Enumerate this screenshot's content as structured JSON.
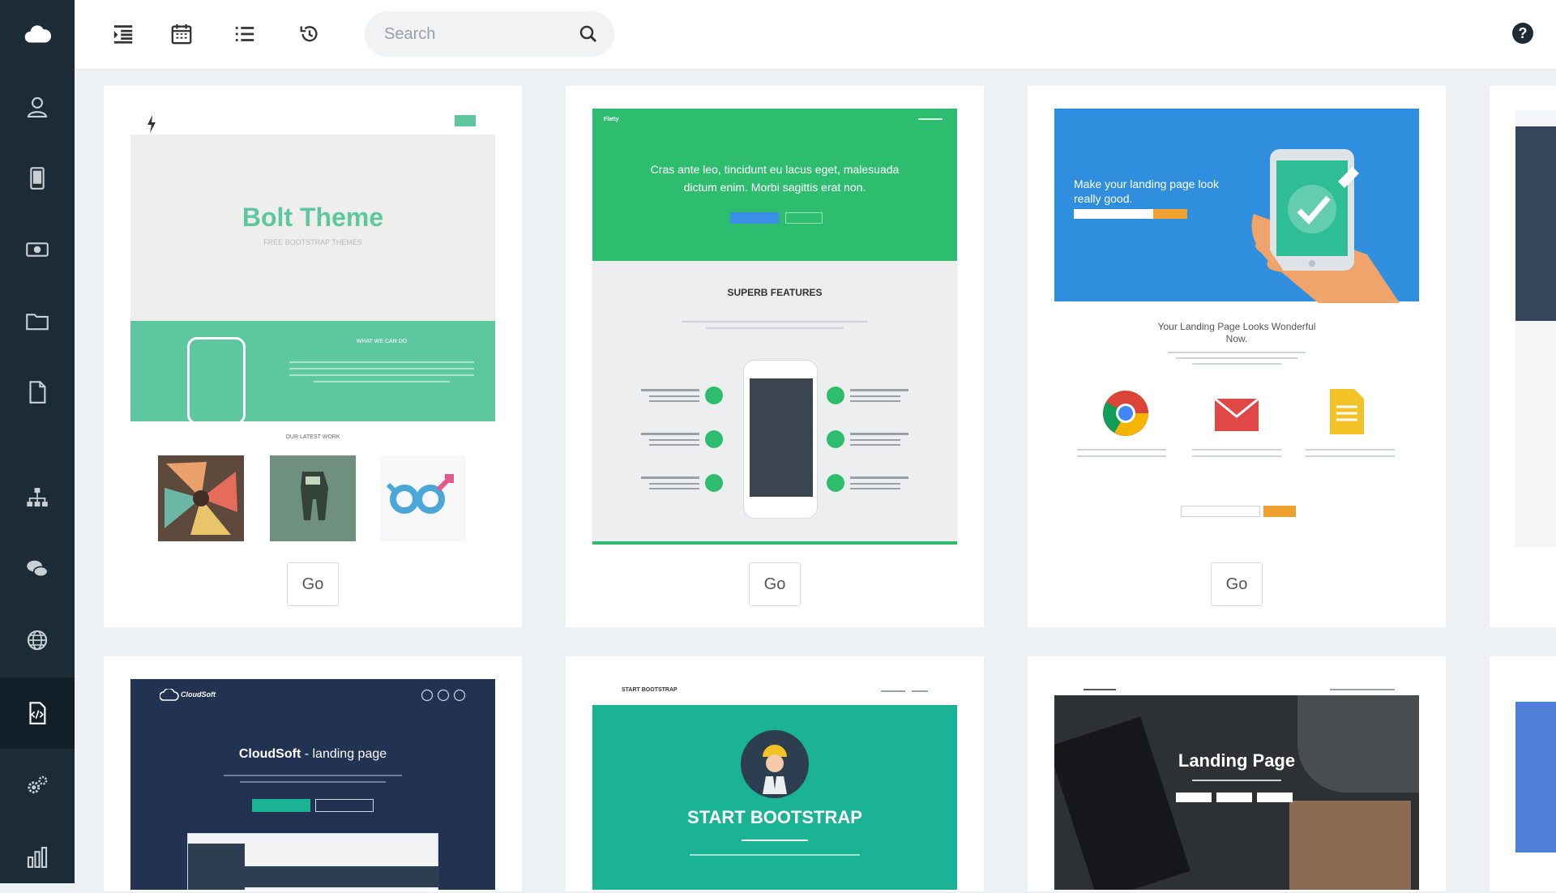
{
  "sidebar": {
    "items": [
      {
        "icon": "cloud-icon"
      },
      {
        "icon": "user-icon"
      },
      {
        "icon": "tablet-icon"
      },
      {
        "icon": "money-icon"
      },
      {
        "icon": "folder-icon"
      },
      {
        "icon": "file-icon"
      },
      {
        "icon": "sitemap-icon"
      },
      {
        "icon": "chat-icon"
      },
      {
        "icon": "globe-icon"
      },
      {
        "icon": "code-file-icon",
        "active": true
      },
      {
        "icon": "cogs-icon"
      },
      {
        "icon": "bar-chart-icon"
      }
    ]
  },
  "toolbar": {
    "icons": [
      "indent-icon",
      "calendar-icon",
      "list-icon",
      "history-icon"
    ],
    "search_placeholder": "Search",
    "help_icon": "?"
  },
  "cards": [
    {
      "name": "bolt",
      "title": "Bolt Theme",
      "subtitle": "FREE BOOTSTRAP THEMES",
      "band_title": "WHAT WE CAN DO",
      "section_title": "OUR LATEST WORK",
      "go_label": "Go"
    },
    {
      "name": "flatty",
      "brand": "Flatty",
      "hero_text": "Cras ante leo, tincidunt eu lacus eget, malesuada dictum enim. Morbi sagittis erat non.",
      "features_title": "SUPERB FEATURES",
      "go_label": "Go"
    },
    {
      "name": "landing",
      "hero_text": "Make your landing page look really good.",
      "heading": "Your Landing Page Looks Wonderful Now.",
      "go_label": "Go"
    },
    {
      "name": "cloudsoft",
      "brand": "CloudSoft",
      "title_bold": "CloudSoft",
      "title_rest": " - landing page"
    },
    {
      "name": "startbootstrap",
      "header": "START BOOTSTRAP",
      "title": "START BOOTSTRAP"
    },
    {
      "name": "landing-page",
      "title": "Landing Page"
    }
  ],
  "colors": {
    "sidebar": "#1c2b36",
    "green": "#5dc8a0",
    "flat_green": "#2ebd6f",
    "blue": "#2f8fde",
    "teal": "#1ab394",
    "navy": "#223253"
  }
}
